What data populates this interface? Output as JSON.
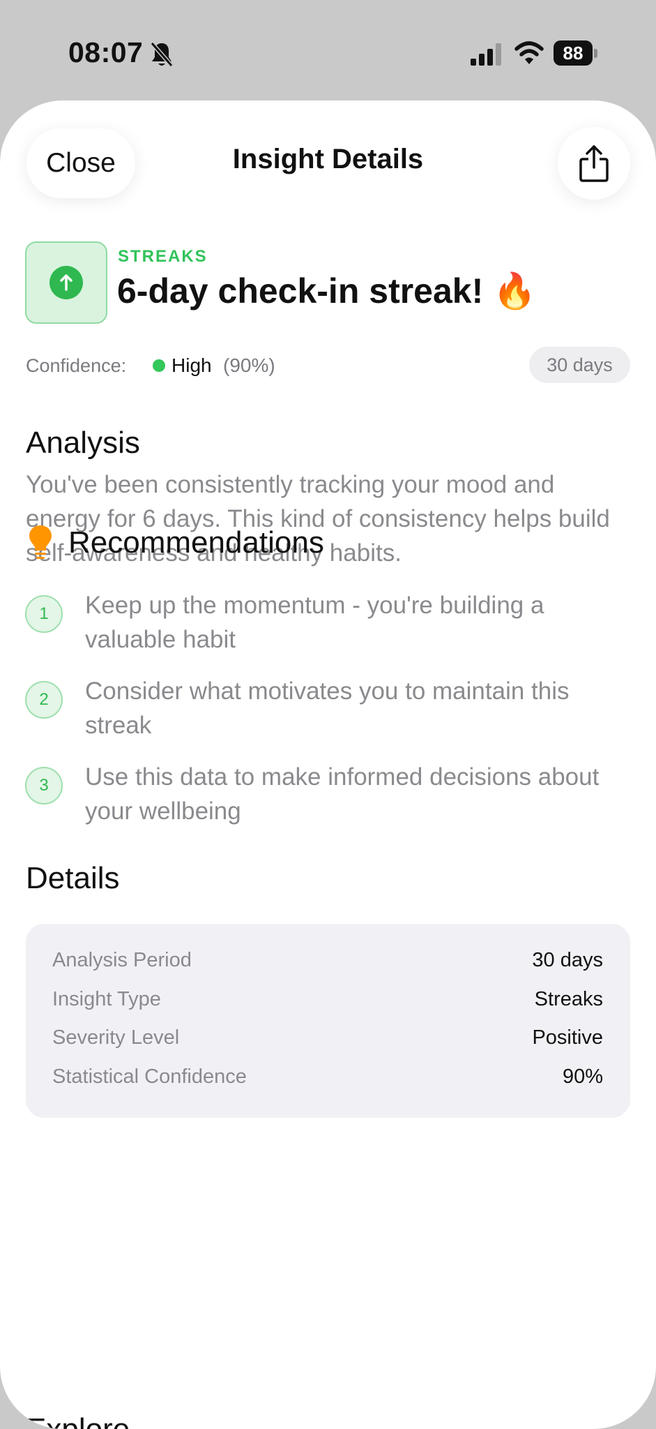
{
  "status_bar": {
    "time": "08:07",
    "battery": "88",
    "icons": [
      "bell-slash-icon",
      "cellular-signal-icon",
      "wifi-icon",
      "battery-icon"
    ]
  },
  "header": {
    "close_label": "Close",
    "title": "Insight Details",
    "share_icon": "share-icon"
  },
  "insight": {
    "category": "STREAKS",
    "title": "6-day check-in streak! 🔥",
    "icon": "arrow-up-circle-icon",
    "accent_color": "#34c759"
  },
  "confidence": {
    "label": "Confidence:",
    "level": "High",
    "percent": "(90%)",
    "period": "30 days"
  },
  "analysis": {
    "title": "Analysis",
    "text": "You've been consistently tracking your mood and energy for 6 days. This kind of consistency helps build self-awareness and healthy habits."
  },
  "recommendations": {
    "title": "Recommendations",
    "icon": "lightbulb-icon",
    "items": [
      {
        "number": "1",
        "text": "Keep up the momentum - you're building a valuable habit"
      },
      {
        "number": "2",
        "text": "Consider what motivates you to maintain this streak"
      },
      {
        "number": "3",
        "text": "Use this data to make informed decisions about your wellbeing"
      }
    ]
  },
  "details": {
    "title": "Details",
    "rows": [
      {
        "label": "Analysis Period",
        "value": "30 days"
      },
      {
        "label": "Insight Type",
        "value": "Streaks"
      },
      {
        "label": "Severity Level",
        "value": "Positive"
      },
      {
        "label": "Statistical Confidence",
        "value": "90%"
      }
    ]
  },
  "next_section_title": "Explore"
}
